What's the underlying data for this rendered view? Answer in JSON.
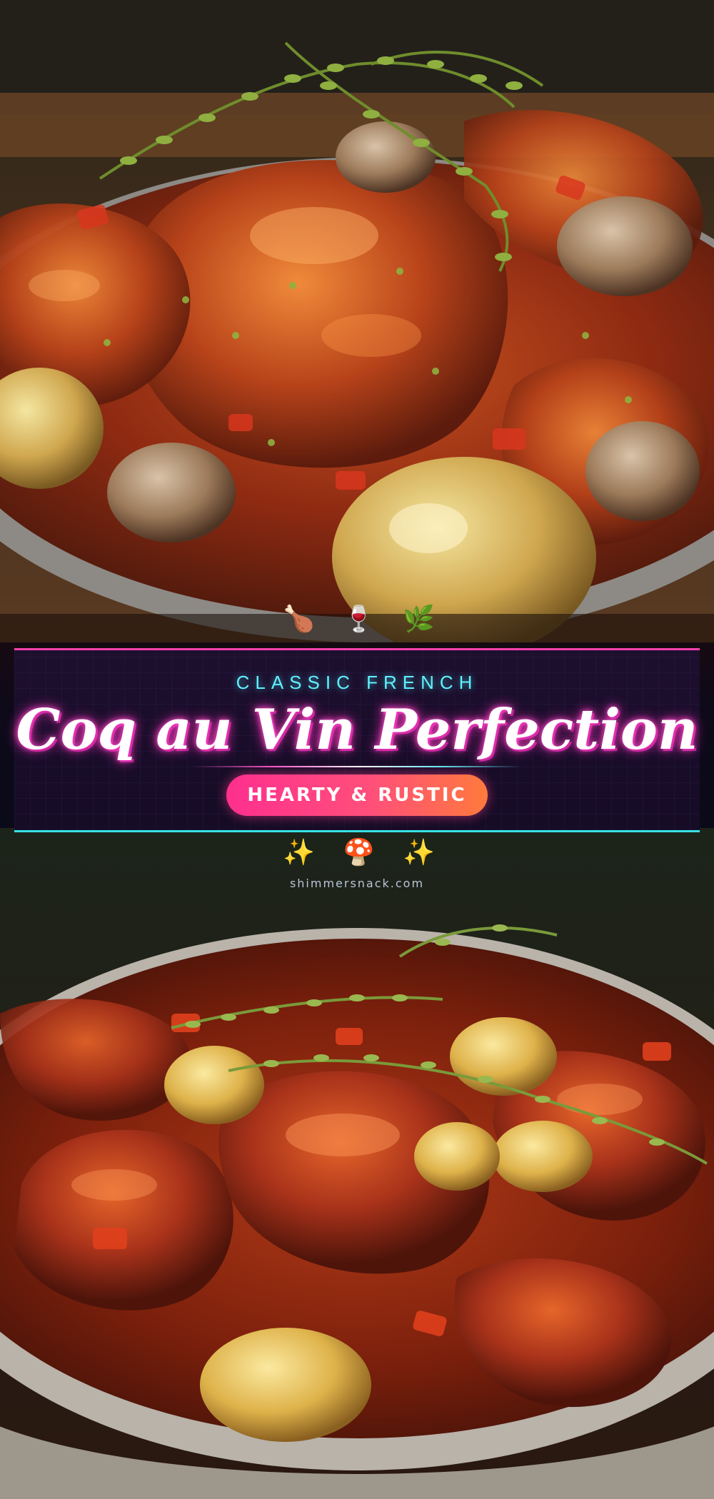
{
  "banner": {
    "kicker": "CLASSIC FRENCH",
    "title": "Coq au Vin Perfection",
    "tag": "HEARTY & RUSTIC",
    "colors": {
      "pink": "#ff3fae",
      "cyan": "#36e3e6",
      "orange": "#ff7a3c"
    }
  },
  "icons_top": [
    "🍗",
    "🍷",
    "🌿"
  ],
  "icons_top_names": [
    "chicken-leg-icon",
    "wine-glass-icon",
    "herb-icon"
  ],
  "icons_bottom": [
    "✨",
    "🍄",
    "✨"
  ],
  "icons_bottom_names": [
    "sparkles-icon",
    "mushroom-icon",
    "sparkles-icon"
  ],
  "site": "shimmersnack.com"
}
